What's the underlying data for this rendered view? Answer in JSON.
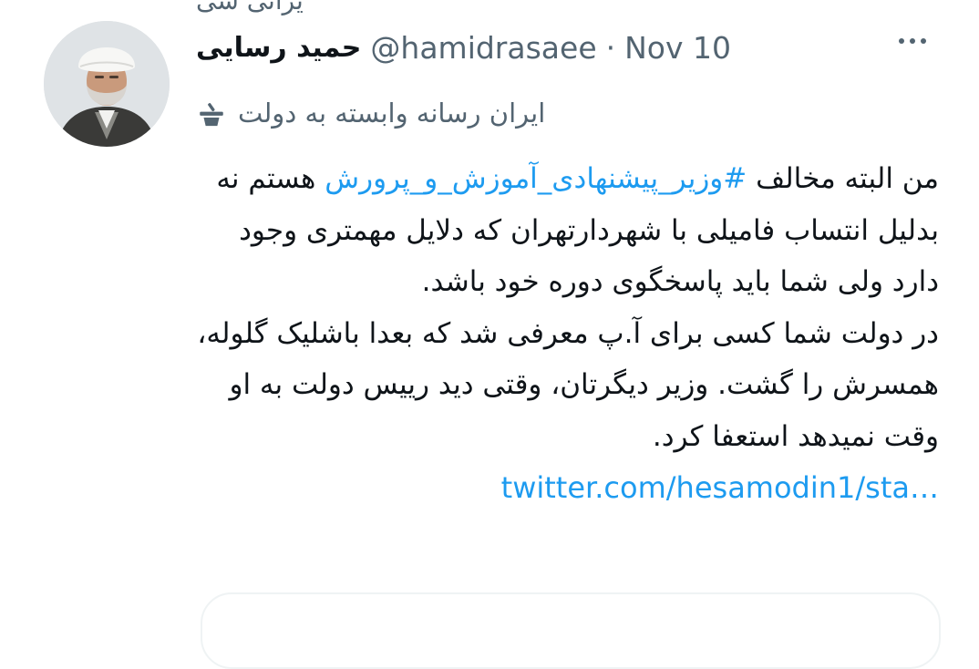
{
  "top_fragment": "یرانی سی",
  "author": {
    "display_name": "حمید رسایی",
    "handle": "@hamidrasaee",
    "separator": "·",
    "date": "Nov 10",
    "avatar_icon": "avatar-cleric-photo"
  },
  "label": {
    "text": "ایران رسانه وابسته به دولت",
    "icon": "state-media-podium-icon"
  },
  "tweet": {
    "p1_before": "من البته مخالف ",
    "hashtag": "#وزیر_پیشنهادی_آموزش_و_پرورش",
    "p1_after": " هستم نه بدلیل انتساب فامیلی با شهردارتهران که دلایل مهمتری وجود دارد ولی شما باید پاسخگوی دوره خود باشد.",
    "p2": "در دولت شما کسی برای آ.پ معرفی شد که بعدا باشلیک گلوله، همسرش را گشت. وزیر دیگرتان، وقتی دید رییس دولت به او وقت نمیدهد استعفا کرد.",
    "link": "twitter.com/hesamodin1/sta…"
  },
  "colors": {
    "link": "#1d9bf0",
    "secondary_text": "#536471",
    "primary_text": "#0f1419"
  }
}
